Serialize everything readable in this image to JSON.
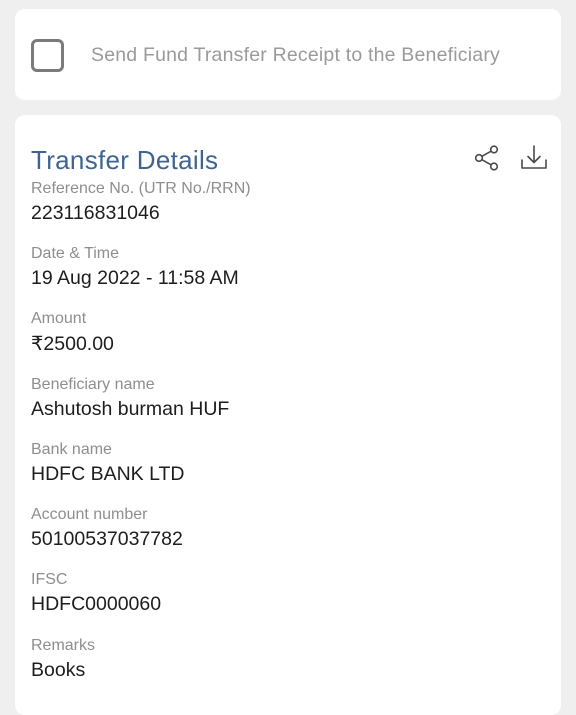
{
  "receipt": {
    "checked": false,
    "label": "Send Fund Transfer Receipt to the Beneficiary"
  },
  "details": {
    "title": "Transfer Details",
    "actions": {
      "share_icon": "share-icon",
      "download_icon": "download-icon"
    },
    "fields": [
      {
        "label": "Reference No. (UTR No./RRN)",
        "value": "223116831046"
      },
      {
        "label": "Date & Time",
        "value": "19 Aug 2022 - 11:58 AM"
      },
      {
        "label": "Amount",
        "value": "₹2500.00"
      },
      {
        "label": "Beneficiary name",
        "value": "Ashutosh burman HUF"
      },
      {
        "label": "Bank name",
        "value": "HDFC BANK LTD"
      },
      {
        "label": "Account number",
        "value": "50100537037782"
      },
      {
        "label": "IFSC",
        "value": "HDFC0000060"
      },
      {
        "label": "Remarks",
        "value": "Books"
      }
    ]
  },
  "colors": {
    "title": "#3f6491",
    "label": "#8e8e8e",
    "value": "#1d1d1d",
    "background": "#efefef",
    "card": "#ffffff"
  }
}
